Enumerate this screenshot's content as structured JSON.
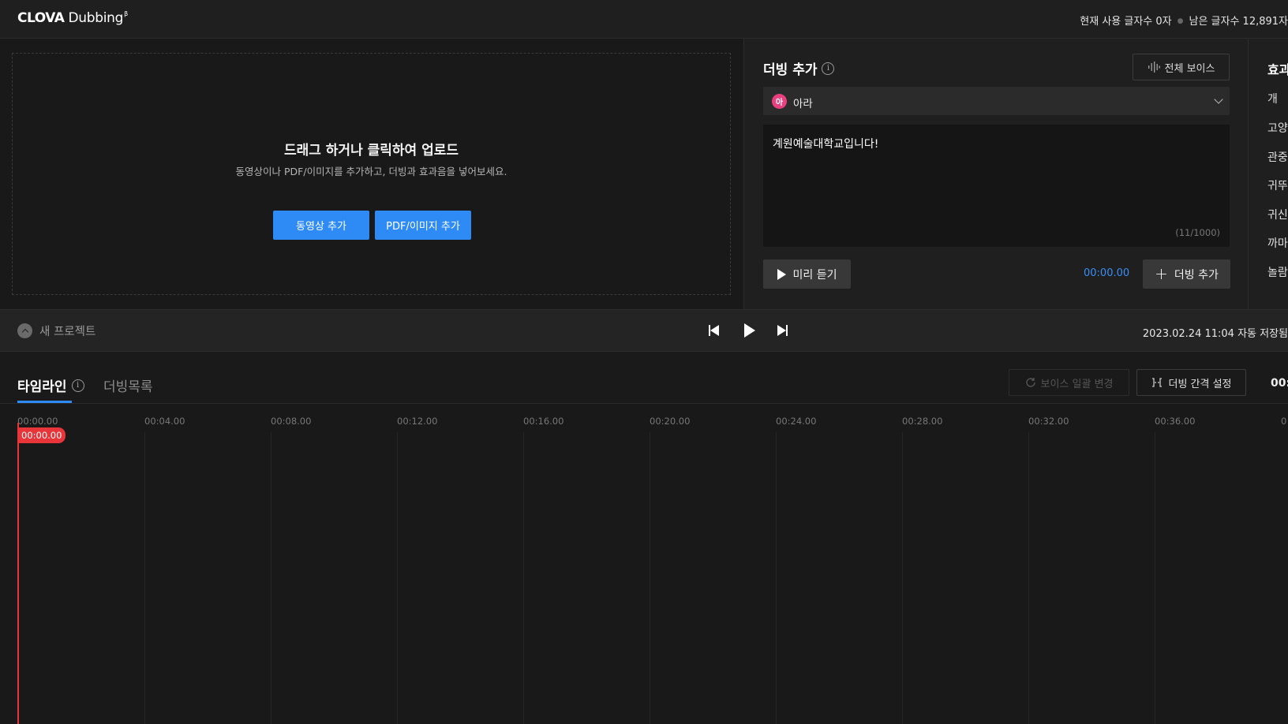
{
  "header": {
    "logo_bold": "CLOVA",
    "logo_rest": "Dubbing",
    "logo_sup": "β",
    "usage_current": "현재 사용 글자수 0자",
    "usage_remaining": "남은 글자수 12,891자"
  },
  "upload": {
    "title": "드래그 하거나 클릭하여 업로드",
    "subtitle": "동영상이나 PDF/이미지를 추가하고, 더빙과 효과음을 넣어보세요.",
    "video_button": "동영상 추가",
    "pdf_button": "PDF/이미지 추가"
  },
  "dubbing": {
    "title": "더빙 추가",
    "all_voice_button": "전체 보이스",
    "voice_avatar": "아",
    "voice_name": "아라",
    "script_text": "계원예술대학교입니다!",
    "char_count": "(11/1000)",
    "preview_button": "미리 듣기",
    "time": "00:00.00",
    "add_button": "더빙 추가"
  },
  "effects": {
    "title": "효과",
    "items": [
      "개",
      "고양",
      "관중",
      "귀뚜",
      "귀신",
      "까마",
      "놀람"
    ]
  },
  "transport": {
    "project_name": "새 프로젝트",
    "autosave": "2023.02.24 11:04 자동 저장됨"
  },
  "timeline": {
    "tab_timeline": "타임라인",
    "tab_dublist": "더빙목록",
    "voice_batch_button": "보이스 일괄 변경",
    "interval_button": "더빙 간격 설정",
    "total_time": "00:",
    "ticks": [
      "00:00.00",
      "00:04.00",
      "00:08.00",
      "00:12.00",
      "00:16.00",
      "00:20.00",
      "00:24.00",
      "00:28.00",
      "00:32.00",
      "00:36.00",
      "0"
    ],
    "playhead": "00:00.00"
  },
  "colors": {
    "accent": "#2e8bf5",
    "playhead": "#e8353a",
    "voice_avatar": "#e8407f"
  }
}
